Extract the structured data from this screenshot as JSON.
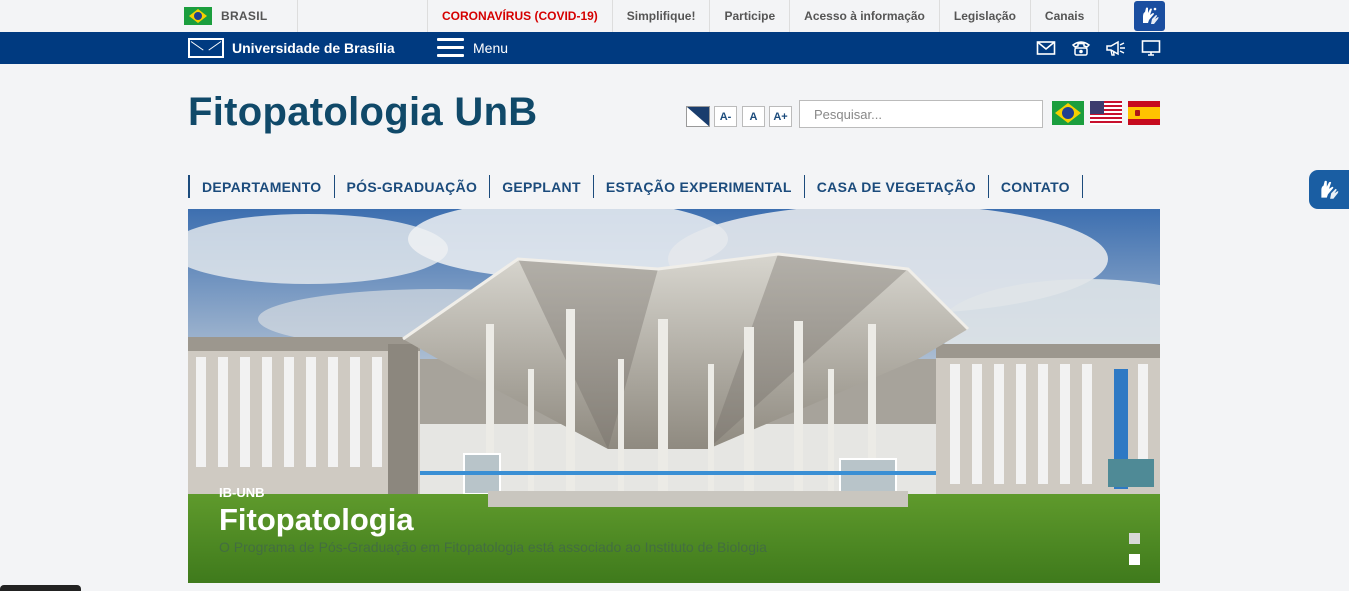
{
  "gov_bar": {
    "country_label": "BRASIL",
    "links": [
      {
        "label": "CORONAVÍRUS (COVID-19)",
        "highlight": true
      },
      {
        "label": "Simplifique!"
      },
      {
        "label": "Participe"
      },
      {
        "label": "Acesso à informação"
      },
      {
        "label": "Legislação"
      },
      {
        "label": "Canais"
      }
    ]
  },
  "unb_bar": {
    "logo_text": "Universidade de Brasília",
    "menu_label": "Menu",
    "icons": [
      "mail-icon",
      "phone-icon",
      "megaphone-icon",
      "monitor-icon"
    ]
  },
  "header": {
    "site_title": "Fitopatologia UnB",
    "font_controls": {
      "decrease": "A-",
      "normal": "A",
      "increase": "A+"
    },
    "search": {
      "placeholder": "Pesquisar...",
      "value": ""
    },
    "languages": [
      "pt-br-flag",
      "en-us-flag",
      "es-flag"
    ]
  },
  "main_nav": {
    "items": [
      {
        "label": "DEPARTAMENTO"
      },
      {
        "label": "PÓS-GRADUAÇÃO"
      },
      {
        "label": "GEPPLANT"
      },
      {
        "label": "ESTAÇÃO EXPERIMENTAL"
      },
      {
        "label": "CASA DE VEGETAÇÃO"
      },
      {
        "label": "CONTATO"
      }
    ]
  },
  "banner": {
    "kicker": "IB-UNB",
    "title": "Fitopatologia",
    "description": "O Programa de Pós-Graduação em Fitopatologia está associado ao Instituto de Biologia",
    "slides": 2,
    "active_slide": 2
  },
  "colors": {
    "unb_blue": "#003a80",
    "title_blue": "#104969",
    "nav_blue": "#1b4b7c",
    "covid_red": "#d50000"
  }
}
